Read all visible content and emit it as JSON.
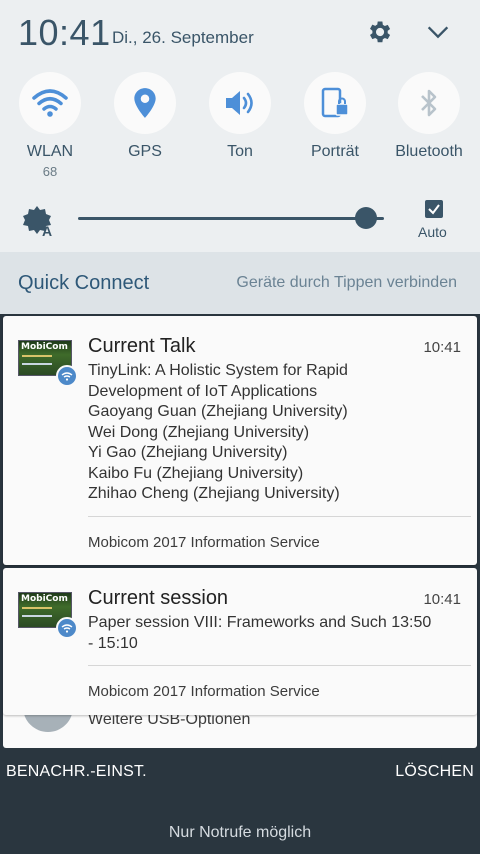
{
  "status": {
    "time": "10:41",
    "date": "Di., 26. September",
    "settings_icon": "gear-icon",
    "expand_icon": "chevron-down-icon"
  },
  "tiles": [
    {
      "label": "WLAN",
      "sub": "68",
      "icon": "wifi-icon",
      "active": true
    },
    {
      "label": "GPS",
      "sub": "",
      "icon": "location-icon",
      "active": true
    },
    {
      "label": "Ton",
      "sub": "",
      "icon": "volume-icon",
      "active": true
    },
    {
      "label": "Porträt",
      "sub": "",
      "icon": "portrait-lock-icon",
      "active": true
    },
    {
      "label": "Bluetooth",
      "sub": "",
      "icon": "bluetooth-icon",
      "active": false
    }
  ],
  "brightness": {
    "level": 0.94,
    "auto_label": "Auto",
    "auto_checked": true
  },
  "quick_connect": {
    "title": "Quick Connect",
    "hint": "Geräte durch Tippen verbinden"
  },
  "notifications": [
    {
      "title": "Current Talk",
      "time": "10:41",
      "lines": [
        "TinyLink: A Holistic System for Rapid",
        "Development of IoT Applications",
        "Gaoyang Guan (Zhejiang University)",
        "Wei Dong (Zhejiang University)",
        "Yi Gao (Zhejiang University)",
        "Kaibo Fu (Zhejiang University)",
        "Zhihao Cheng (Zhejiang University)"
      ],
      "source": "Mobicom 2017 Information Service",
      "thumb_text": "MobiCom 2017"
    },
    {
      "title": "Current session",
      "time": "10:41",
      "lines": [
        "Paper session VIII: Frameworks and Such 13:50",
        "- 15:10"
      ],
      "source": "Mobicom 2017 Information Service",
      "thumb_text": "MobiCom 2017"
    }
  ],
  "usb": {
    "label": "Weitere USB-Optionen"
  },
  "actions": {
    "settings_label": "BENACHR.-EINST.",
    "clear_label": "LÖSCHEN"
  },
  "footer": {
    "emergency": "Nur Notrufe möglich"
  },
  "colors": {
    "accent": "#3a5568",
    "active_icon": "#4d8fd8",
    "inactive_icon": "#b8c3cb",
    "bottom_bg": "#2a363f"
  }
}
